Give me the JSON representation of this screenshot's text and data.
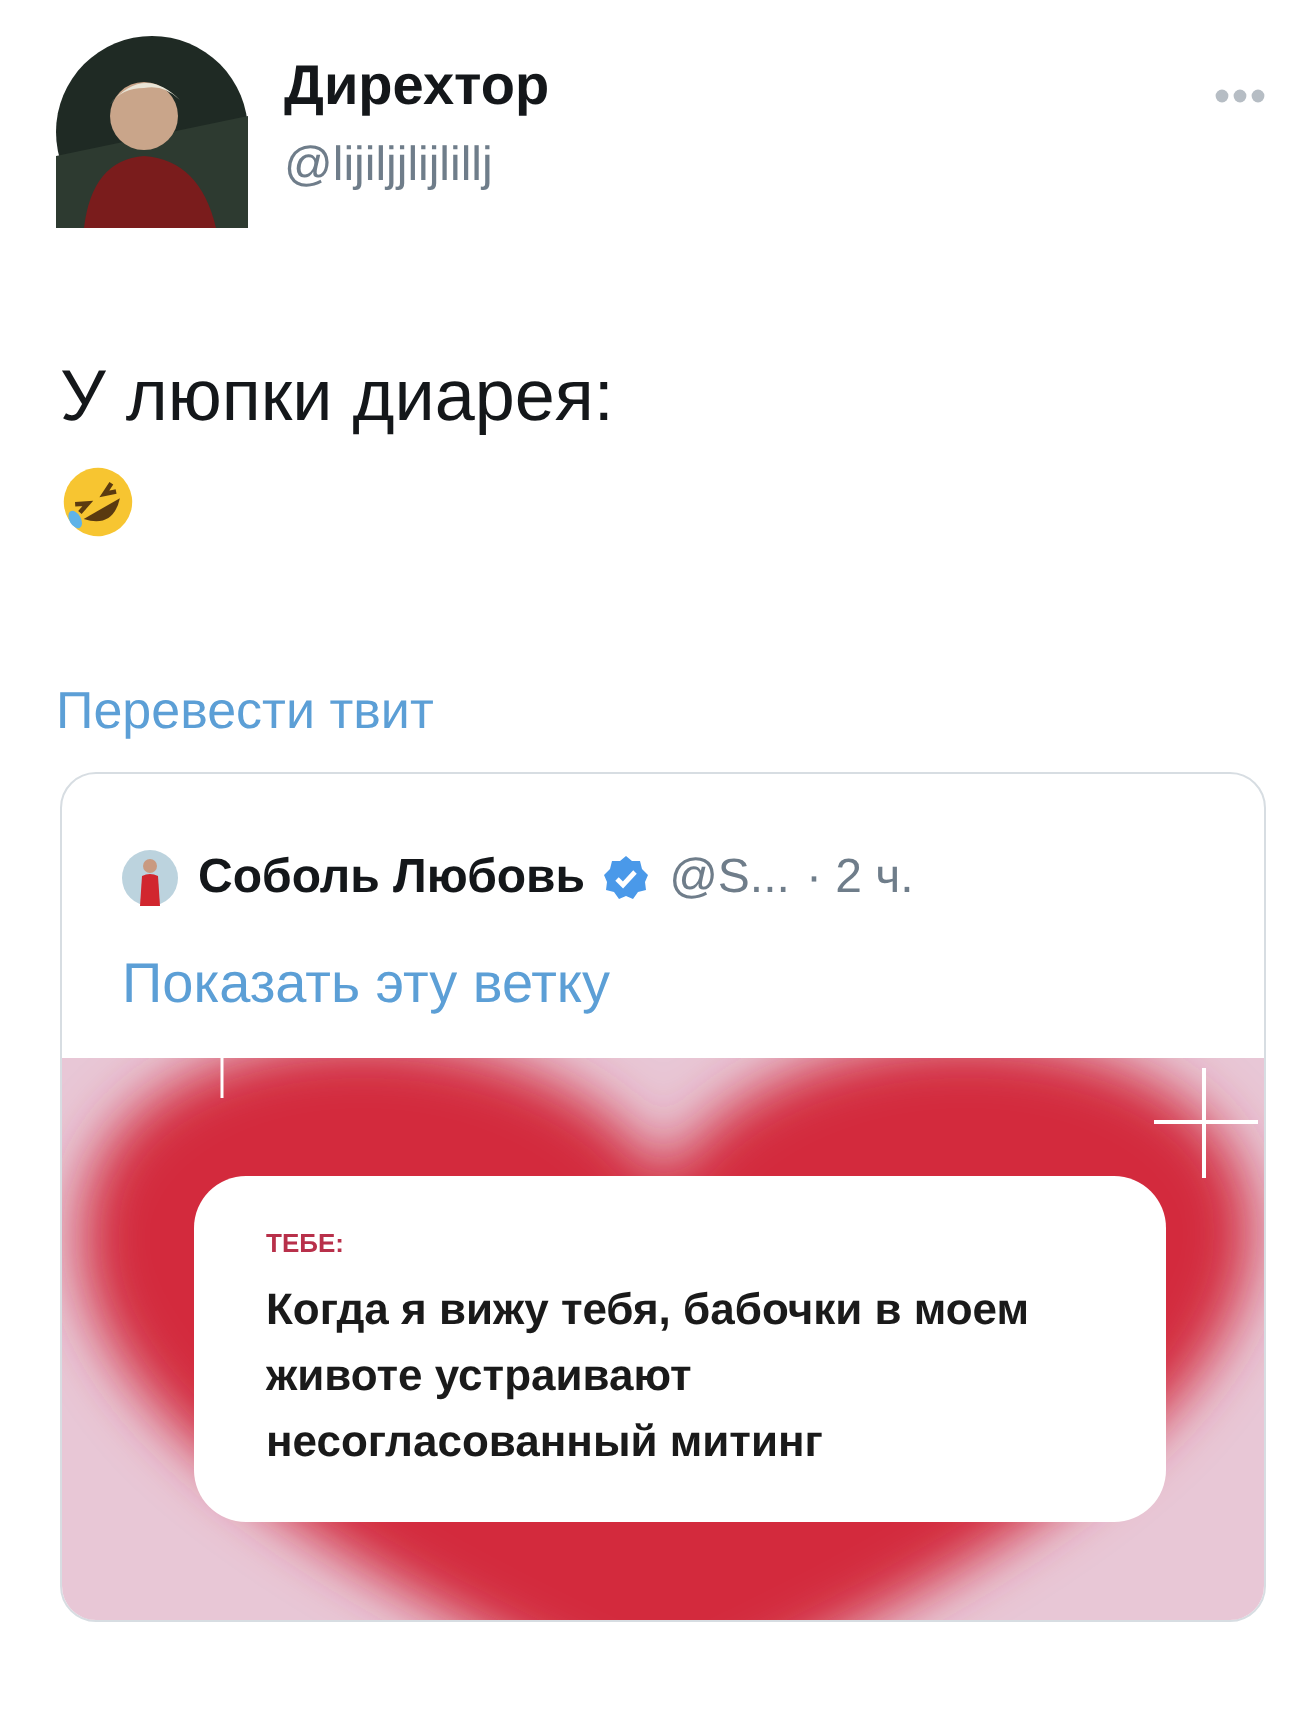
{
  "author": {
    "name": "Дирехтор",
    "handle": "@lijiljjlijlillj"
  },
  "tweet": {
    "text": "У люпки диарея:"
  },
  "translate_link": "Перевести твит",
  "quoted_tweet": {
    "name": "Соболь Любовь",
    "verified": true,
    "handle": "@S...",
    "time": "· 2 ч.",
    "thread_link": "Показать эту ветку",
    "media": {
      "label": "ТЕБЕ:",
      "message": "Когда я вижу тебя, бабочки в моем животе устраивают несогласованный митинг"
    }
  }
}
